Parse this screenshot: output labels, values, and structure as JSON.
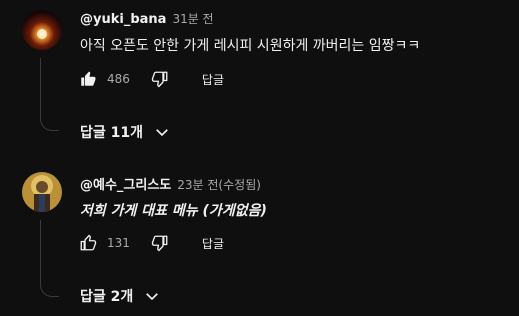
{
  "comments": [
    {
      "author": "@yuki_bana",
      "time": "31분 전",
      "text": "아직 오픈도 안한 가게 레시피 시원하게 까버리는 임짱ㅋㅋ",
      "likes": "486",
      "reply_label": "답글",
      "replies_label": "답글 11개"
    },
    {
      "author": "@예수_그리스도",
      "time": "23분 전(수정됨)",
      "text": "저희 가게 대표 메뉴 (가게없음)",
      "likes": "131",
      "reply_label": "답글",
      "replies_label": "답글 2개"
    }
  ],
  "icons": {
    "like_filled": "thumbs-up-filled-icon",
    "like_outline": "thumbs-up-outline-icon",
    "dislike": "thumbs-down-icon",
    "expand": "chevron-down-icon"
  },
  "colors": {
    "background": "#0f0f0f",
    "text": "#f1f1f1",
    "muted": "#aaaaaa"
  }
}
